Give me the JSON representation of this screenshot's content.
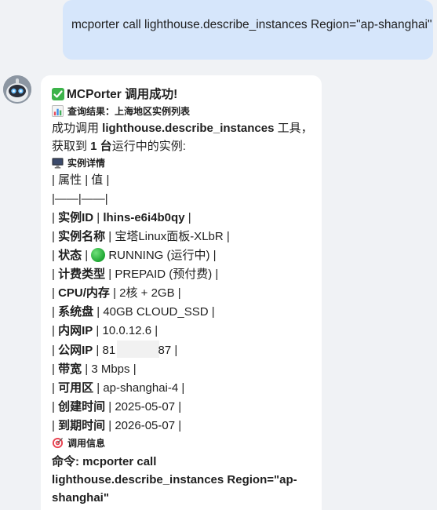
{
  "user_message": "mcporter call lighthouse.describe_instances Region=\"ap-shanghai\"",
  "bot": {
    "title_emoji": "check-mark-icon",
    "title": "MCPorter 调用成功!",
    "query_emoji": "bar-chart-icon",
    "query_result": "查询结果：上海地区实例列表",
    "intro_1": "成功调用 ",
    "intro_method": "lighthouse.describe_instances",
    "intro_2": " 工具，获取到 ",
    "intro_count": "1 台",
    "intro_3": "运行中的实例:",
    "details_emoji": "desktop-computer-icon",
    "details_heading": "实例详情",
    "table_header": "| 属性 | 值 |",
    "table_separator": "|——|——|",
    "rows": [
      {
        "label": "实例ID",
        "value": "lhins-e6i4b0qy",
        "value_bold": true
      },
      {
        "label": "实例名称",
        "value": "宝塔Linux面板-XLbR"
      },
      {
        "label": "状态",
        "value": "RUNNING (运行中)",
        "status_icon": "green-circle-icon"
      },
      {
        "label": "计费类型",
        "value": "PREPAID (预付费)"
      },
      {
        "label": "CPU/内存",
        "value": "2核 + 2GB"
      },
      {
        "label": "系统盘",
        "value": "40GB CLOUD_SSD"
      },
      {
        "label": "内网IP",
        "value": "10.0.12.6"
      },
      {
        "label": "公网IP",
        "value_prefix": "81",
        "value_suffix": "87"
      },
      {
        "label": "带宽",
        "value": "3 Mbps"
      },
      {
        "label": "可用区",
        "value": "ap-shanghai-4"
      },
      {
        "label": "创建时间",
        "value": "2025-05-07"
      },
      {
        "label": "到期时间",
        "value": "2026-05-07"
      }
    ],
    "call_info_emoji": "direct-hit-icon",
    "call_info_heading": "调用信息",
    "command_label": "命令:",
    "command_text": "mcporter call lighthouse.describe_instances Region=\"ap-shanghai\""
  },
  "colors": {
    "background": "#f0f2f5",
    "user_bubble": "#d6e6fb",
    "bot_bubble": "#ffffff",
    "check_green": "#3cb34a",
    "status_green": "#1ea632"
  }
}
